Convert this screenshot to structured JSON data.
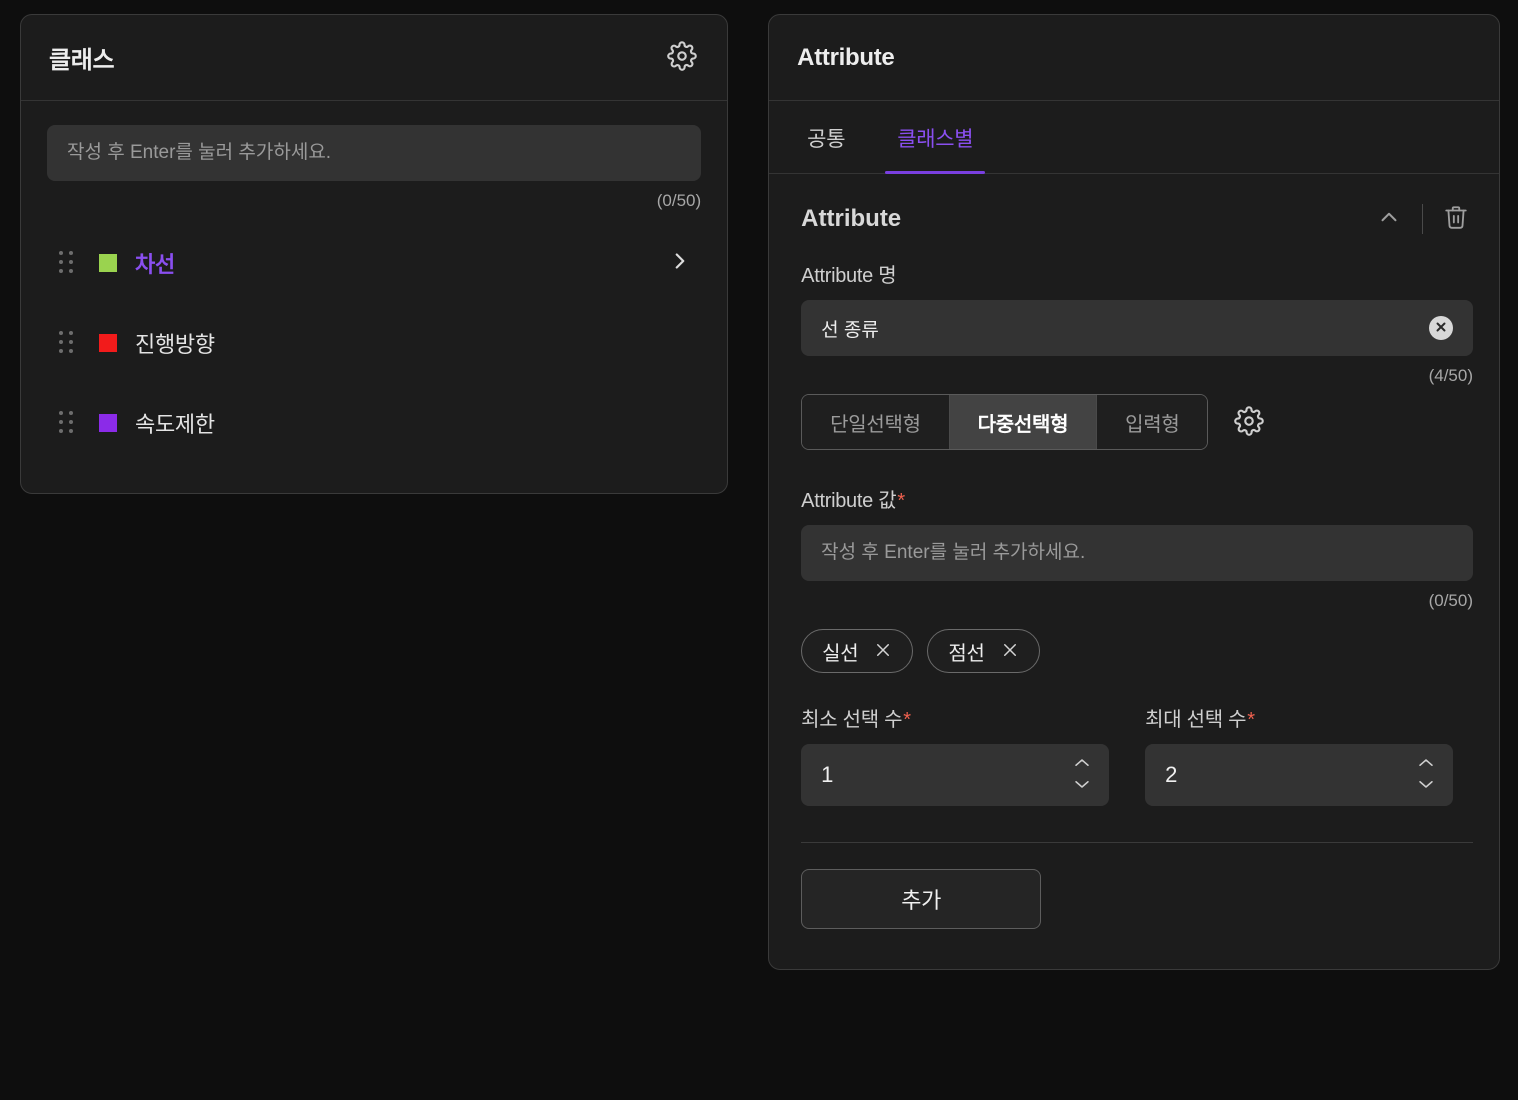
{
  "class_panel": {
    "title": "클래스",
    "settings_icon": "gear-icon",
    "new_class_input": {
      "value": "",
      "placeholder": "작성 후 Enter를 눌러 추가하세요."
    },
    "counter": "(0/50)",
    "classes": [
      {
        "label": "차선",
        "color": "#9ad34f",
        "selected": true,
        "chevron": "chevron-right-icon"
      },
      {
        "label": "진행방향",
        "color": "#f21b1b",
        "selected": false,
        "chevron": ""
      },
      {
        "label": "속도제한",
        "color": "#8b2be8",
        "selected": false,
        "chevron": ""
      }
    ]
  },
  "attribute_panel": {
    "title": "Attribute",
    "tabs": [
      {
        "label": "공통",
        "active": false
      },
      {
        "label": "클래스별",
        "active": true
      }
    ],
    "section": {
      "title": "Attribute",
      "collapse_icon": "chevron-up-icon",
      "delete_icon": "trash-icon"
    },
    "attribute_name": {
      "label": "Attribute 명",
      "value": "선 종류",
      "placeholder": "",
      "counter": "(4/50)",
      "clear_icon": "clear-circle-icon"
    },
    "input_type": {
      "options": [
        {
          "label": "단일선택형",
          "active": false
        },
        {
          "label": "다중선택형",
          "active": true
        },
        {
          "label": "입력형",
          "active": false
        }
      ],
      "settings_icon": "gear-icon"
    },
    "attribute_value": {
      "label": "Attribute 값",
      "required": "*",
      "input": {
        "value": "",
        "placeholder": "작성 후 Enter를 눌러 추가하세요."
      },
      "counter": "(0/50)",
      "tags": [
        {
          "label": "실선",
          "remove_icon": "close-icon"
        },
        {
          "label": "점선",
          "remove_icon": "close-icon"
        }
      ]
    },
    "min_select": {
      "label": "최소 선택 수",
      "required": "*",
      "value": "1"
    },
    "max_select": {
      "label": "최대 선택 수",
      "required": "*",
      "value": "2"
    },
    "add_button": "추가"
  },
  "colors": {
    "accent": "#8a4ff0",
    "accent_underline": "#7a3fe0",
    "required": "#f0614f",
    "page_bg": "#0e0e0e",
    "panel_bg": "#1c1c1c",
    "input_bg": "#333333"
  }
}
